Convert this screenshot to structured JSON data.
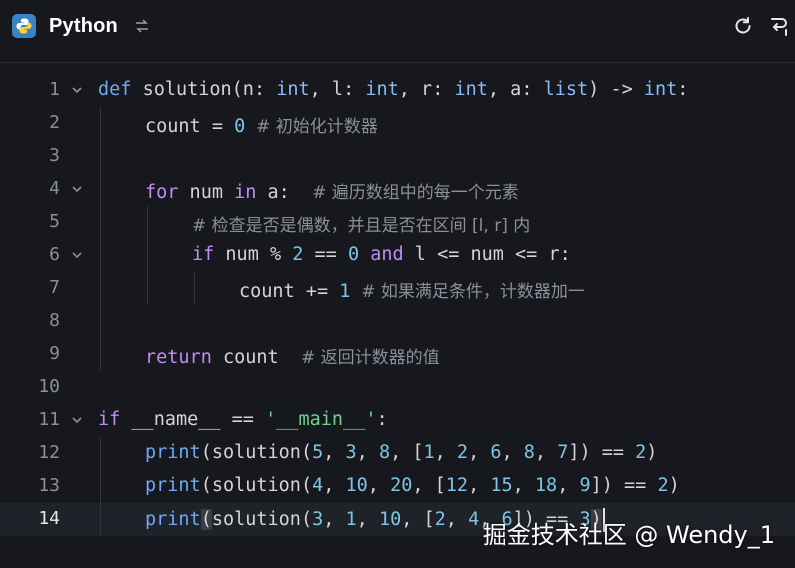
{
  "header": {
    "language": "Python",
    "icons": {
      "logo": "python-logo-icon",
      "switch": "swap-icon",
      "reset": "refresh-icon",
      "format": "format-icon"
    }
  },
  "editor": {
    "active_line": 14,
    "lines": [
      {
        "n": "1"
      },
      {
        "n": "2"
      },
      {
        "n": "3"
      },
      {
        "n": "4"
      },
      {
        "n": "5"
      },
      {
        "n": "6"
      },
      {
        "n": "7"
      },
      {
        "n": "8"
      },
      {
        "n": "9"
      },
      {
        "n": "10"
      },
      {
        "n": "11"
      },
      {
        "n": "12"
      },
      {
        "n": "13"
      },
      {
        "n": "14"
      }
    ],
    "code": {
      "l1": [
        "def",
        " ",
        "solution",
        "(n: ",
        "int",
        ", l: ",
        "int",
        ", r: ",
        "int",
        ", a: ",
        "list",
        ") -> ",
        "int",
        ":"
      ],
      "l2": [
        "count = ",
        "0",
        "  # 初始化计数器"
      ],
      "l4": [
        "for",
        " num ",
        "in",
        " a:  ",
        "# 遍历数组中的每一个元素"
      ],
      "l5": [
        "# 检查是否是偶数，并且是否在区间 [l, r] 内"
      ],
      "l6": [
        "if",
        " num % ",
        "2",
        " == ",
        "0",
        " ",
        "and",
        " l <= num <= r:"
      ],
      "l7": [
        "count += ",
        "1",
        "  # 如果满足条件，计数器加一"
      ],
      "l9": [
        "return",
        " count  ",
        "# 返回计数器的值"
      ],
      "l11": [
        "if",
        " __name__ == ",
        "'__main__'",
        ":"
      ],
      "l12": [
        "print",
        "(solution(",
        "5",
        ", ",
        "3",
        ", ",
        "8",
        ", [",
        "1",
        ", ",
        "2",
        ", ",
        "6",
        ", ",
        "8",
        ", ",
        "7",
        "]) == ",
        "2",
        ")"
      ],
      "l13": [
        "print",
        "(solution(",
        "4",
        ", ",
        "10",
        ", ",
        "20",
        ", [",
        "12",
        ", ",
        "15",
        ", ",
        "18",
        ", ",
        "9",
        "]) == ",
        "2",
        ")"
      ],
      "l14": [
        "print",
        "(",
        "solution(",
        "3",
        ", ",
        "1",
        ", ",
        "10",
        ", [",
        "2",
        ", ",
        "4",
        ", ",
        "6",
        "]) == ",
        "3",
        ")"
      ]
    }
  },
  "watermark": "掘金技术社区 @ Wendy_1"
}
